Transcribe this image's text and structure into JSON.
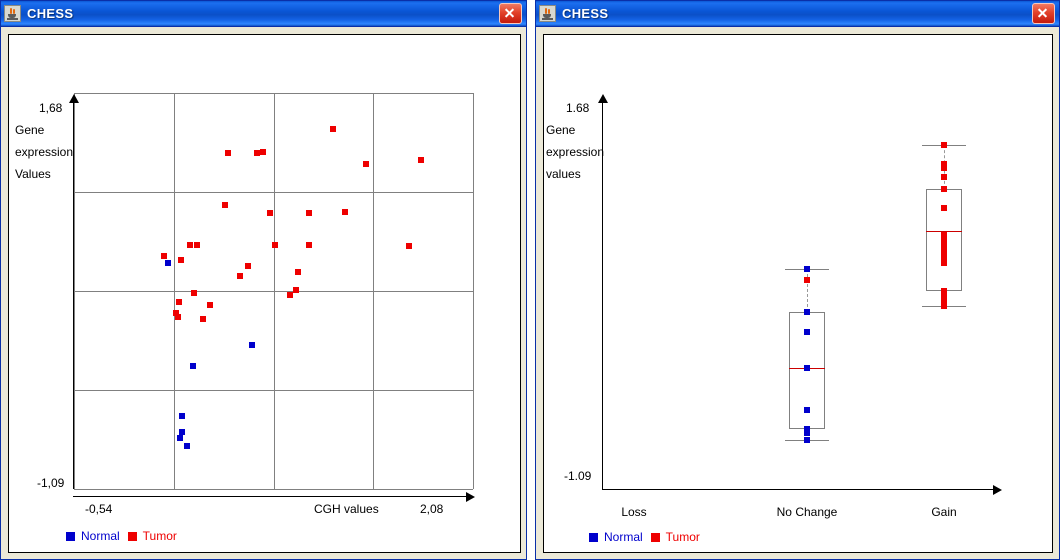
{
  "windows": {
    "left": {
      "title": "CHESS",
      "icon": "java-coffee-cup-icon",
      "close_label": "Close"
    },
    "right": {
      "title": "CHESS",
      "icon": "java-coffee-cup-icon",
      "close_label": "Close"
    }
  },
  "legend": {
    "normal": "Normal",
    "tumor": "Tumor",
    "normal_color": "#0000CC",
    "tumor_color": "#EE0000"
  },
  "chart_data": [
    {
      "type": "scatter",
      "title": "",
      "xlabel": "CGH values",
      "ylabel": "Gene expression Values",
      "ylabel_lines": [
        "Gene",
        "expression",
        "Values"
      ],
      "ytick_top": "1,68",
      "ytick_bottom": "-1,09",
      "xtick_left": "-0,54",
      "xtick_right": "2,08",
      "xlim": [
        -0.54,
        2.08
      ],
      "ylim": [
        -1.09,
        1.68
      ],
      "grid": true,
      "grid_cols": 4,
      "grid_rows": 4,
      "legend_position": "bottom-left",
      "series": [
        {
          "name": "Tumor",
          "color": "#EE0000",
          "points": [
            [
              0.47,
              1.26
            ],
            [
              0.66,
              1.26
            ],
            [
              0.7,
              1.27
            ],
            [
              1.16,
              1.43
            ],
            [
              1.38,
              1.18
            ],
            [
              1.74,
              1.21
            ],
            [
              0.75,
              0.84
            ],
            [
              0.45,
              0.9
            ],
            [
              1.0,
              0.84
            ],
            [
              1.24,
              0.85
            ],
            [
              0.22,
              0.62
            ],
            [
              0.27,
              0.62
            ],
            [
              0.78,
              0.62
            ],
            [
              1.0,
              0.62
            ],
            [
              1.66,
              0.61
            ],
            [
              0.05,
              0.54
            ],
            [
              0.16,
              0.51
            ],
            [
              0.6,
              0.47
            ],
            [
              0.55,
              0.4
            ],
            [
              0.93,
              0.43
            ],
            [
              0.92,
              0.3
            ],
            [
              0.25,
              0.28
            ],
            [
              0.88,
              0.27
            ],
            [
              0.15,
              0.22
            ],
            [
              0.35,
              0.2
            ],
            [
              0.13,
              0.14
            ],
            [
              0.14,
              0.11
            ],
            [
              0.31,
              0.1
            ]
          ]
        },
        {
          "name": "Normal",
          "color": "#0000CC",
          "points": [
            [
              0.08,
              0.49
            ],
            [
              0.63,
              -0.08
            ],
            [
              0.24,
              -0.23
            ],
            [
              0.17,
              -0.58
            ],
            [
              0.17,
              -0.69
            ],
            [
              0.155,
              -0.73
            ],
            [
              0.2,
              -0.79
            ]
          ]
        }
      ]
    },
    {
      "type": "boxplot",
      "title": "",
      "xlabel": "",
      "ylabel": "Gene expression values",
      "ylabel_lines": [
        "Gene",
        "expression",
        "values"
      ],
      "ytick_top": "1.68",
      "ytick_bottom": "-1.09",
      "ylim": [
        -1.09,
        1.68
      ],
      "categories": [
        "Loss",
        "No Change",
        "Gain"
      ],
      "legend_position": "bottom-left",
      "boxes": [
        {
          "category": "Loss",
          "empty": true
        },
        {
          "category": "No Change",
          "whisker_low": -0.74,
          "q1": -0.66,
          "median": -0.22,
          "q3": 0.18,
          "whisker_high": 0.49,
          "points": [
            {
              "series": "Normal",
              "value": 0.49
            },
            {
              "series": "Tumor",
              "value": 0.41
            },
            {
              "series": "Tumor",
              "value": 0.18
            },
            {
              "series": "Normal",
              "value": 0.18
            },
            {
              "series": "Normal",
              "value": 0.04
            },
            {
              "series": "Normal",
              "value": -0.22
            },
            {
              "series": "Normal",
              "value": -0.52
            },
            {
              "series": "Normal",
              "value": -0.66
            },
            {
              "series": "Normal",
              "value": -0.69
            },
            {
              "series": "Normal",
              "value": -0.74
            }
          ]
        },
        {
          "category": "Gain",
          "whisker_low": 0.22,
          "q1": 0.33,
          "median": 0.76,
          "q3": 1.06,
          "whisker_high": 1.38,
          "points": [
            {
              "series": "Tumor",
              "value": 1.38
            },
            {
              "series": "Tumor",
              "value": 1.24
            },
            {
              "series": "Tumor",
              "value": 1.21
            },
            {
              "series": "Tumor",
              "value": 1.15
            },
            {
              "series": "Tumor",
              "value": 1.06
            },
            {
              "series": "Tumor",
              "value": 0.93
            },
            {
              "series": "Tumor",
              "value": 0.73
            },
            {
              "series": "Tumor",
              "value": 0.69
            },
            {
              "series": "Tumor",
              "value": 0.65
            },
            {
              "series": "Tumor",
              "value": 0.61
            },
            {
              "series": "Tumor",
              "value": 0.57
            },
            {
              "series": "Tumor",
              "value": 0.53
            },
            {
              "series": "Tumor",
              "value": 0.33
            },
            {
              "series": "Tumor",
              "value": 0.29
            },
            {
              "series": "Tumor",
              "value": 0.25
            },
            {
              "series": "Tumor",
              "value": 0.22
            }
          ]
        }
      ]
    }
  ]
}
